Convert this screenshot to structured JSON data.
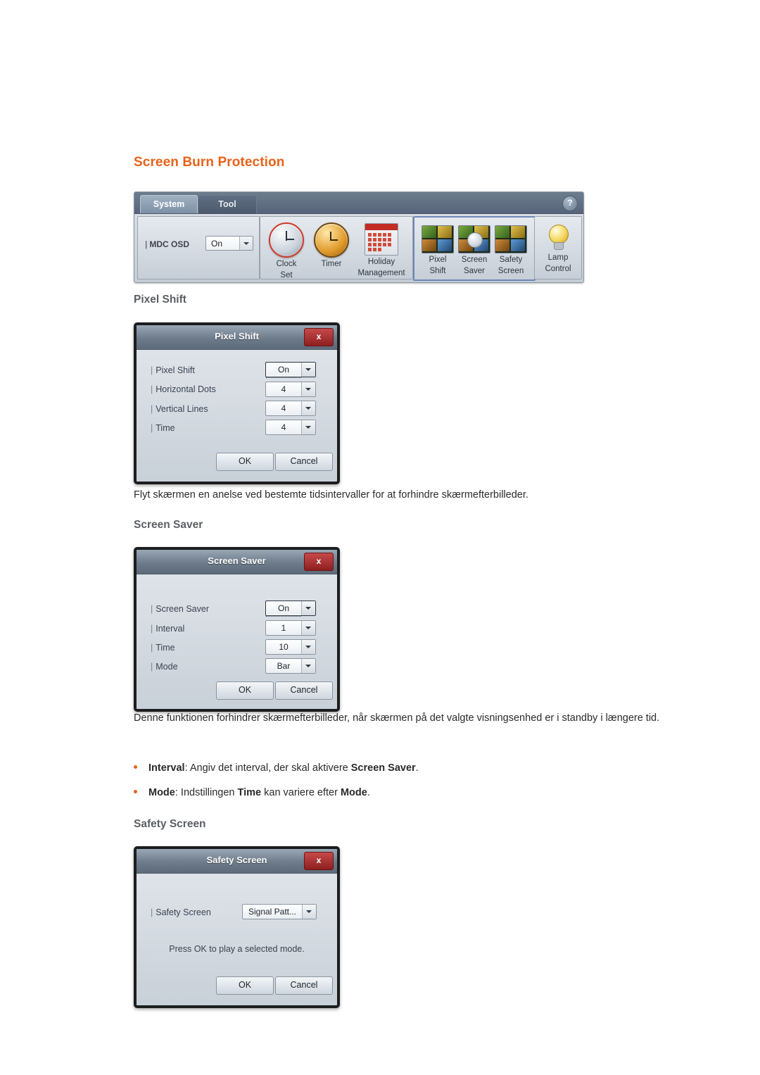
{
  "page": {
    "section_title": "Screen Burn Protection",
    "paragraph_pixel_shift": "Flyt skærmen en anelse ved bestemte tidsintervaller for at forhindre skærmefterbilleder.",
    "paragraph_screen_saver": "Denne funktionen forhindrer skærmefterbilleder, når skærmen på det valgte visningsenhed er i standby i længere tid.",
    "sub_pixel_shift": "Pixel Shift",
    "sub_screen_saver": "Screen Saver",
    "sub_safety_screen": "Safety Screen"
  },
  "bullets": [
    {
      "term": "Interval",
      "mid": ": Angiv det interval, der skal aktivere ",
      "term2": "Screen Saver",
      "end": "."
    },
    {
      "term": "Mode",
      "mid": ": Indstillingen ",
      "term2": "Time",
      "mid2": " kan variere efter ",
      "term3": "Mode",
      "end": "."
    }
  ],
  "mdc_toolbar": {
    "tabs": [
      {
        "label": "System",
        "active": true
      },
      {
        "label": "Tool",
        "active": false
      }
    ],
    "help_glyph": "?",
    "osd": {
      "label": "MDC OSD",
      "value": "On"
    },
    "tools": [
      {
        "name": "clock-set",
        "line1": "Clock",
        "line2": "Set"
      },
      {
        "name": "timer",
        "line1": "Timer",
        "line2": ""
      },
      {
        "name": "holiday-management",
        "line1": "Holiday",
        "line2": "Management"
      },
      {
        "name": "pixel-shift",
        "line1": "Pixel",
        "line2": "Shift"
      },
      {
        "name": "screen-saver",
        "line1": "Screen",
        "line2": "Saver"
      },
      {
        "name": "safety-screen",
        "line1": "Safety",
        "line2": "Screen"
      },
      {
        "name": "lamp-control",
        "line1": "Lamp",
        "line2": "Control"
      }
    ]
  },
  "dialog_pixel_shift": {
    "title": "Pixel Shift",
    "close": "x",
    "rows": [
      {
        "label": "Pixel Shift",
        "value": "On"
      },
      {
        "label": "Horizontal Dots",
        "value": "4"
      },
      {
        "label": "Vertical Lines",
        "value": "4"
      },
      {
        "label": "Time",
        "value": "4"
      }
    ],
    "ok": "OK",
    "cancel": "Cancel"
  },
  "dialog_screen_saver": {
    "title": "Screen Saver",
    "close": "x",
    "rows": [
      {
        "label": "Screen Saver",
        "value": "On"
      },
      {
        "label": "Interval",
        "value": "1"
      },
      {
        "label": "Time",
        "value": "10"
      },
      {
        "label": "Mode",
        "value": "Bar"
      }
    ],
    "ok": "OK",
    "cancel": "Cancel"
  },
  "dialog_safety_screen": {
    "title": "Safety Screen",
    "close": "x",
    "row_label": "Safety Screen",
    "row_value": "Signal Patt...",
    "note": "Press OK to play a selected mode.",
    "ok": "OK",
    "cancel": "Cancel"
  },
  "colors": {
    "accent": "#e8621a",
    "subhead": "#5a5f64",
    "text": "#2b2b2b"
  }
}
